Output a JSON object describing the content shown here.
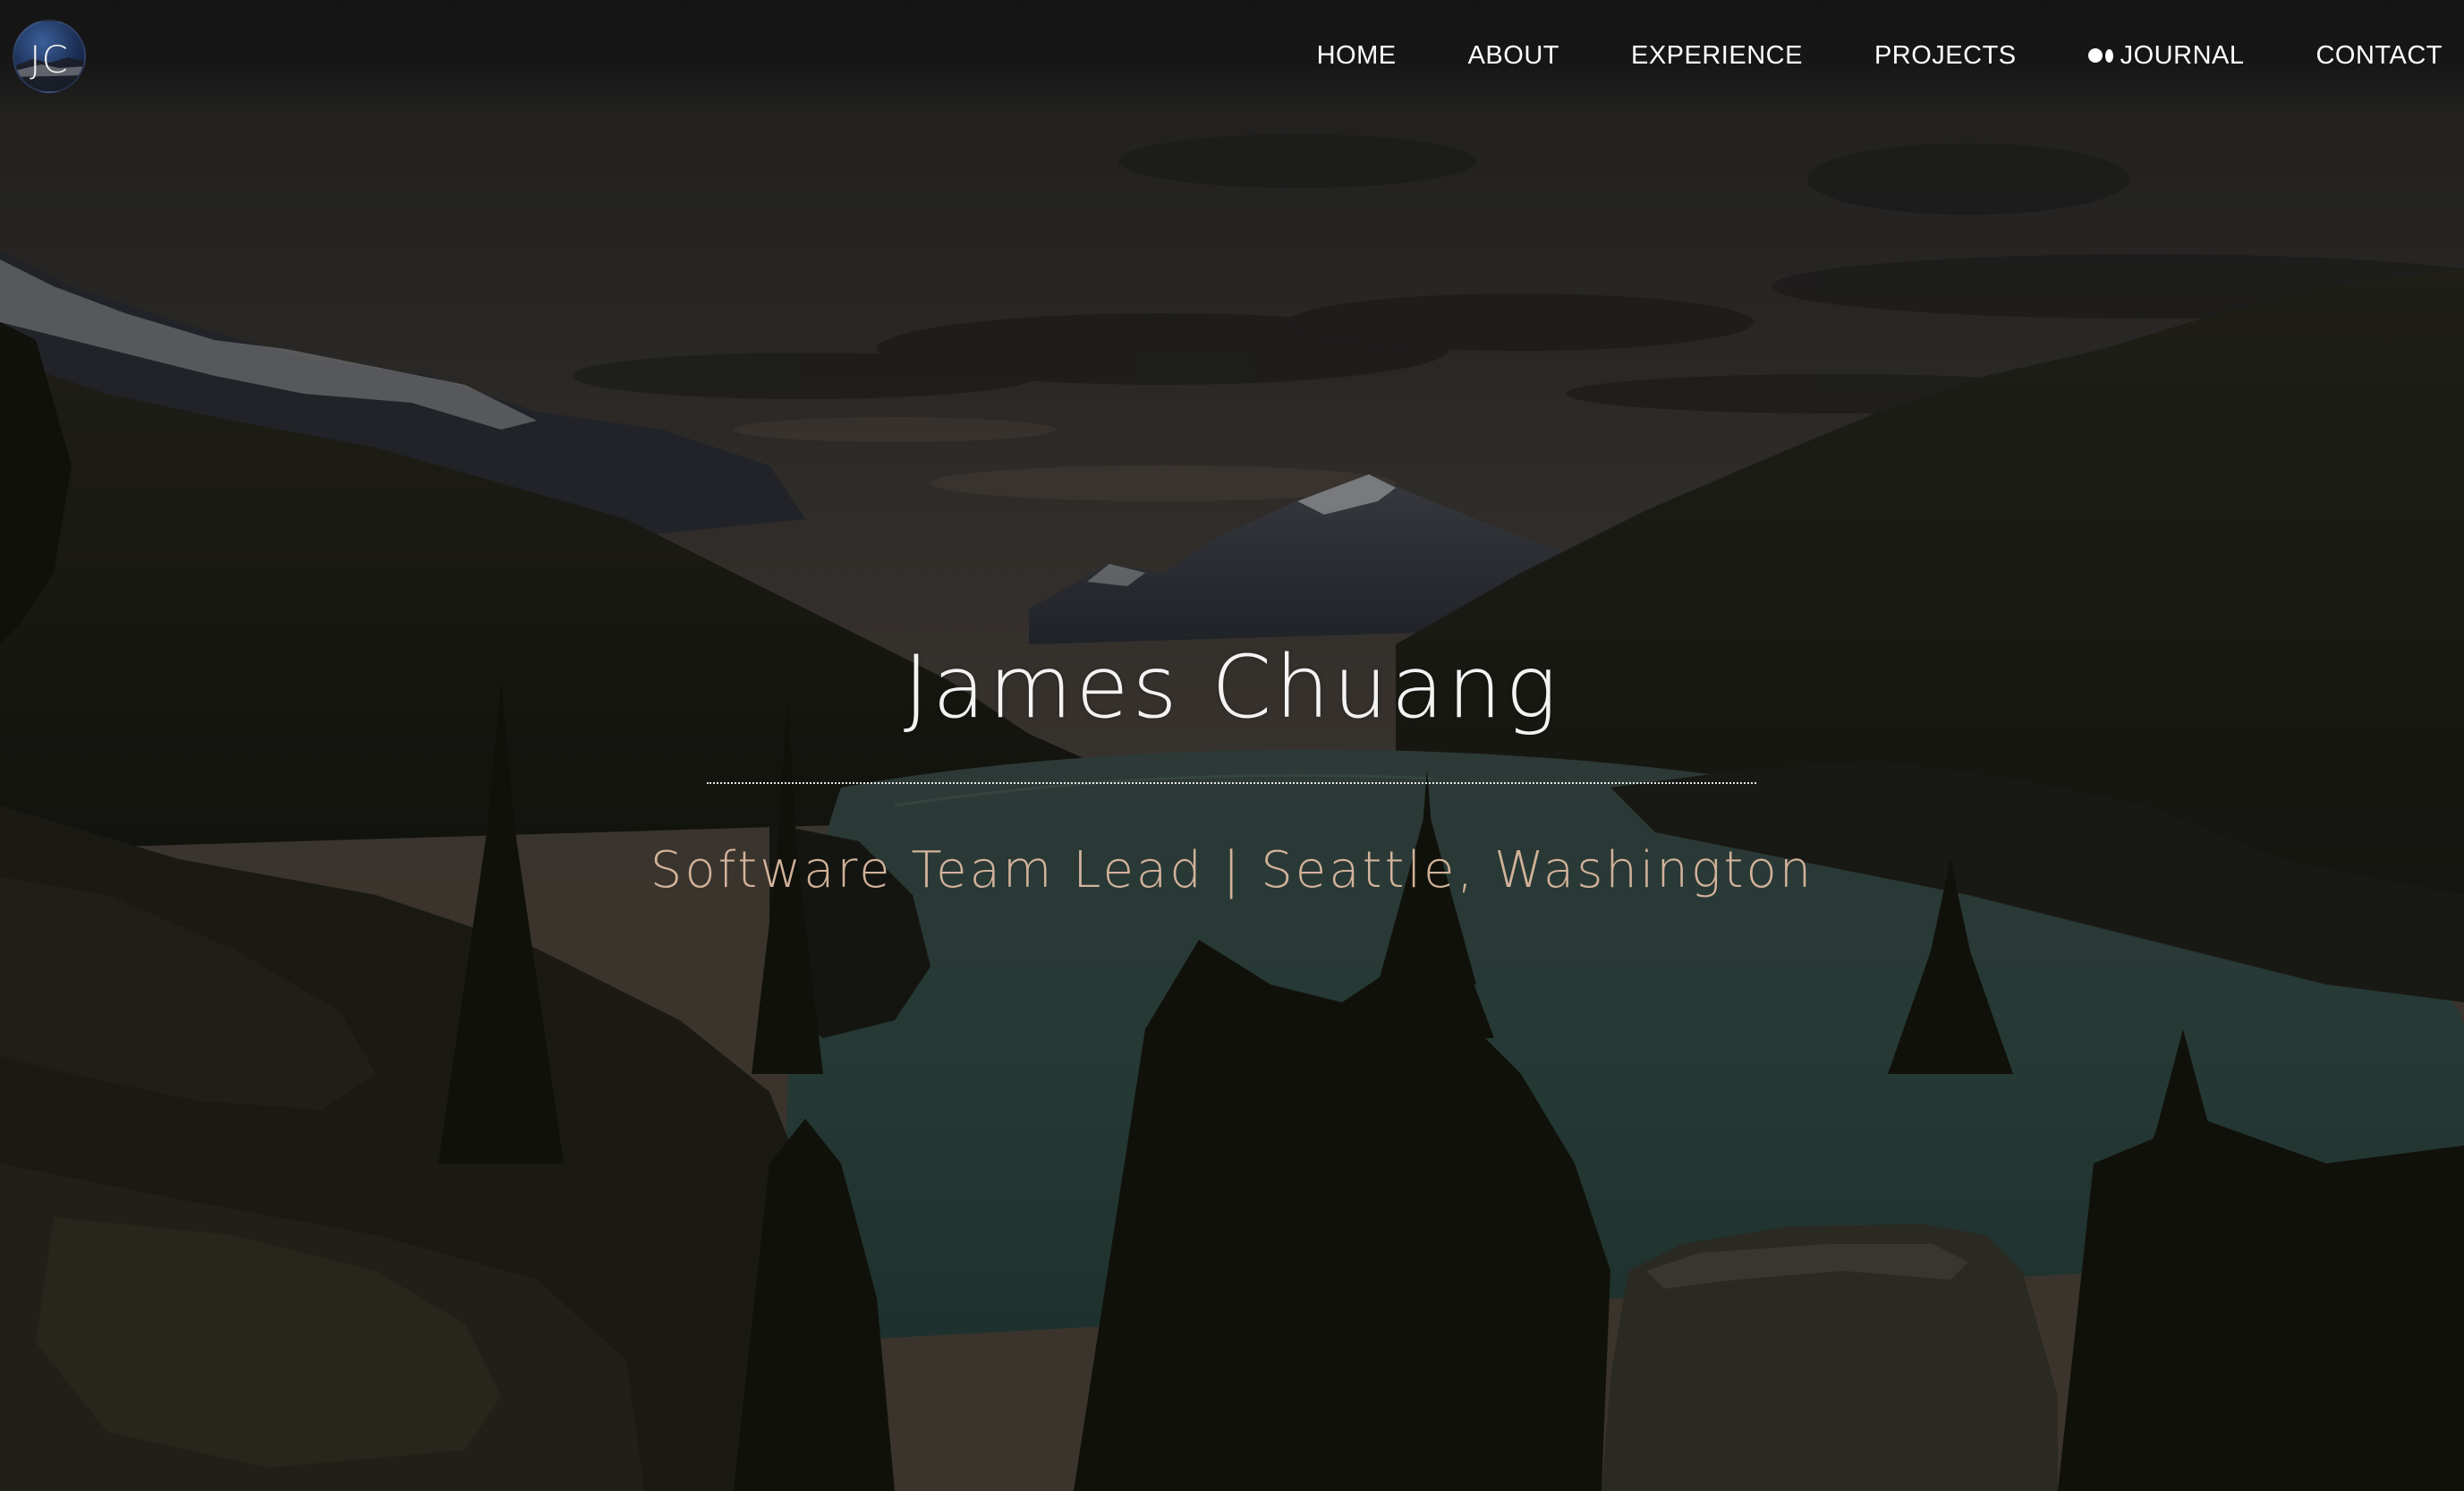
{
  "brand": {
    "logo_text": "JC"
  },
  "nav": {
    "items": [
      {
        "label": "HOME"
      },
      {
        "label": "ABOUT"
      },
      {
        "label": "EXPERIENCE"
      },
      {
        "label": "PROJECTS"
      },
      {
        "label": "JOURNAL",
        "icon": "medium-icon"
      },
      {
        "label": "CONTACT"
      }
    ]
  },
  "hero": {
    "title": "James Chuang",
    "subtitle": "Software Team Lead | Seattle, Washington",
    "background": "mountain-lake-landscape"
  },
  "colors": {
    "nav_text": "#ffffff",
    "title_text": "#f3f3f3",
    "subtitle_text": "#d2b29a",
    "topbar": "#141414"
  }
}
